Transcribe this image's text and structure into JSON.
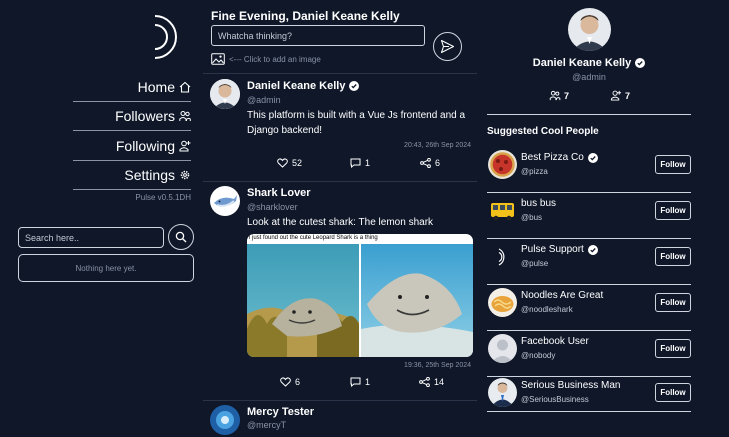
{
  "app": {
    "version": "Pulse v0.5.1DH"
  },
  "nav": {
    "items": [
      {
        "label": "Home",
        "icon": "home-icon"
      },
      {
        "label": "Followers",
        "icon": "followers-icon"
      },
      {
        "label": "Following",
        "icon": "following-icon"
      },
      {
        "label": "Settings",
        "icon": "gear-icon"
      }
    ]
  },
  "search": {
    "placeholder": "Search here..",
    "empty_text": "Nothing here yet."
  },
  "feed": {
    "greeting": "Fine Evening, Daniel Keane Kelly",
    "composer_placeholder": "Whatcha thinking?",
    "add_image_label": "<--- Click to add an image",
    "posts": [
      {
        "name": "Daniel Keane Kelly",
        "handle": "@admin",
        "verified": true,
        "text": "This platform is built with a Vue Js frontend and a Django backend!",
        "timestamp": "20:43, 26th Sep 2024",
        "likes": "52",
        "comments": "1",
        "shares": "6"
      },
      {
        "name": "Shark Lover",
        "handle": "@sharklover",
        "verified": false,
        "text": "Look at the cutest shark: The lemon shark",
        "image_caption": "i just found out the cute Leopard Shark is a thing",
        "timestamp": "19:36, 25th Sep 2024",
        "likes": "6",
        "comments": "1",
        "shares": "14"
      },
      {
        "name": "Mercy Tester",
        "handle": "@mercyT",
        "verified": false
      }
    ]
  },
  "profile": {
    "name": "Daniel Keane Kelly",
    "handle": "@admin",
    "followers": "7",
    "following": "7"
  },
  "suggested": {
    "title": "Suggested Cool People",
    "follow_label": "Follow",
    "people": [
      {
        "name": "Best Pizza Co",
        "handle": "@pizza",
        "verified": true
      },
      {
        "name": "bus bus",
        "handle": "@bus",
        "verified": false
      },
      {
        "name": "Pulse Support",
        "handle": "@pulse",
        "verified": true
      },
      {
        "name": "Noodles Are Great",
        "handle": "@noodleshark",
        "verified": false
      },
      {
        "name": "Facebook User",
        "handle": "@nobody",
        "verified": false
      },
      {
        "name": "Serious Business Man",
        "handle": "@SeriousBusiness",
        "verified": false
      }
    ]
  },
  "colors": {
    "background": "#0f1729",
    "muted": "#8a93a6",
    "divider": "#2a3348"
  }
}
